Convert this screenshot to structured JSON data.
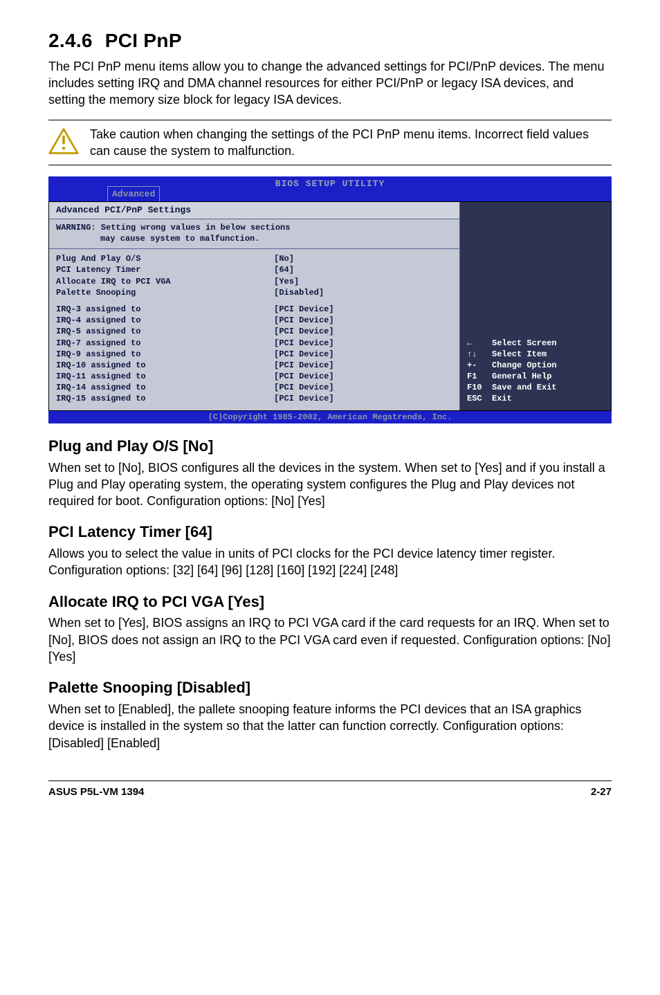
{
  "section": {
    "number": "2.4.6",
    "title": "PCI PnP",
    "intro": "The PCI PnP menu items allow you to change the advanced settings for PCI/PnP devices. The menu includes setting IRQ and DMA channel resources for either PCI/PnP or legacy ISA devices, and setting the memory size block for legacy ISA devices."
  },
  "caution": "Take caution when changing the settings of the PCI PnP menu items. Incorrect field values can cause the system to malfunction.",
  "bios": {
    "header_title": "BIOS SETUP UTILITY",
    "tab": "Advanced",
    "subheader": "Advanced PCI/PnP Settings",
    "warning_line1": "WARNING: Setting wrong values in below sections",
    "warning_line2": "may cause system to malfunction.",
    "settings": [
      {
        "label": "Plug And Play O/S",
        "value": "[No]"
      },
      {
        "label": "PCI Latency Timer",
        "value": "[64]"
      },
      {
        "label": "Allocate IRQ to PCI VGA",
        "value": "[Yes]"
      },
      {
        "label": "Palette Snooping",
        "value": "[Disabled]"
      }
    ],
    "irqs": [
      {
        "label": "IRQ-3 assigned to",
        "value": "[PCI Device]"
      },
      {
        "label": "IRQ-4 assigned to",
        "value": "[PCI Device]"
      },
      {
        "label": "IRQ-5 assigned to",
        "value": "[PCI Device]"
      },
      {
        "label": "IRQ-7 assigned to",
        "value": "[PCI Device]"
      },
      {
        "label": "IRQ-9 assigned to",
        "value": "[PCI Device]"
      },
      {
        "label": "IRQ-10 assigned to",
        "value": "[PCI Device]"
      },
      {
        "label": "IRQ-11 assigned to",
        "value": "[PCI Device]"
      },
      {
        "label": "IRQ-14 assigned to",
        "value": "[PCI Device]"
      },
      {
        "label": "IRQ-15 assigned to",
        "value": "[PCI Device]"
      }
    ],
    "help": [
      {
        "key": "←",
        "text": "Select Screen"
      },
      {
        "key": "↑↓",
        "text": "Select Item"
      },
      {
        "key": "+-",
        "text": "Change Option"
      },
      {
        "key": "F1",
        "text": "General Help"
      },
      {
        "key": "F10",
        "text": "Save and Exit"
      },
      {
        "key": "ESC",
        "text": "Exit"
      }
    ],
    "footer": "(C)Copyright 1985-2002, American Megatrends, Inc."
  },
  "options": [
    {
      "title": "Plug and Play O/S [No]",
      "body": "When set to [No], BIOS configures all the devices in the system. When set to [Yes] and if you install a Plug and Play operating system, the operating system configures the Plug and Play devices not required for boot. Configuration options: [No] [Yes]"
    },
    {
      "title": "PCI Latency Timer [64]",
      "body": "Allows you to select the value in units of PCI clocks for the PCI device latency timer register. Configuration options: [32] [64] [96] [128] [160] [192] [224] [248]"
    },
    {
      "title": "Allocate IRQ to PCI VGA [Yes]",
      "body": "When set to [Yes], BIOS assigns an IRQ to PCI VGA card if the card requests for an IRQ. When set to [No], BIOS does not assign an IRQ to the PCI VGA card even if requested. Configuration options: [No] [Yes]"
    },
    {
      "title": "Palette Snooping [Disabled]",
      "body": "When set to [Enabled], the pallete snooping feature informs the PCI devices that an ISA graphics device is installed in the system so that the latter can function correctly. Configuration options: [Disabled] [Enabled]"
    }
  ],
  "footer": {
    "left": "ASUS P5L-VM 1394",
    "right": "2-27"
  }
}
